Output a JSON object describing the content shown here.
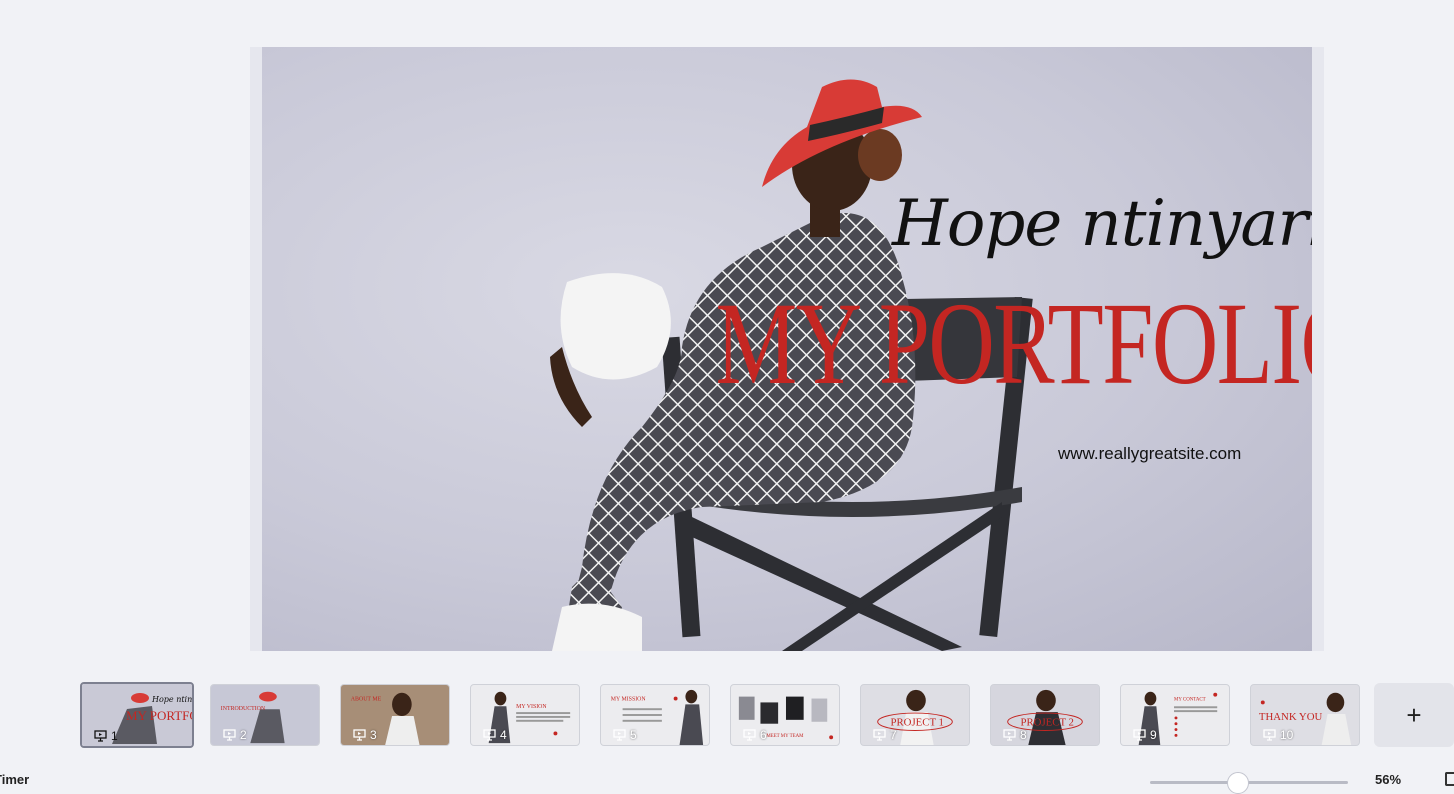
{
  "slide": {
    "name": "Hope ntinyari",
    "title": "MY PORTFOLIO",
    "url": "www.reallygreatsite.com"
  },
  "thumbnails": [
    {
      "number": "1",
      "label": "MY PORTFOLIO",
      "active": true
    },
    {
      "number": "2",
      "label": "INTRODUCTION"
    },
    {
      "number": "3",
      "label": "ABOUT ME"
    },
    {
      "number": "4",
      "label": "MY VISION"
    },
    {
      "number": "5",
      "label": "MY MISSION"
    },
    {
      "number": "6",
      "label": "MEET MY TEAM"
    },
    {
      "number": "7",
      "label": "PROJECT 1"
    },
    {
      "number": "8",
      "label": "PROJECT 2"
    },
    {
      "number": "9",
      "label": "MY CONTACT"
    },
    {
      "number": "10",
      "label": "THANK YOU"
    }
  ],
  "add_slide_label": "+",
  "footer": {
    "timer_label": "Timer",
    "zoom": "56%"
  },
  "colors": {
    "accent_red": "#c42622",
    "background": "#f1f2f6"
  },
  "icons": [
    "presenter-icon",
    "plus-icon"
  ]
}
